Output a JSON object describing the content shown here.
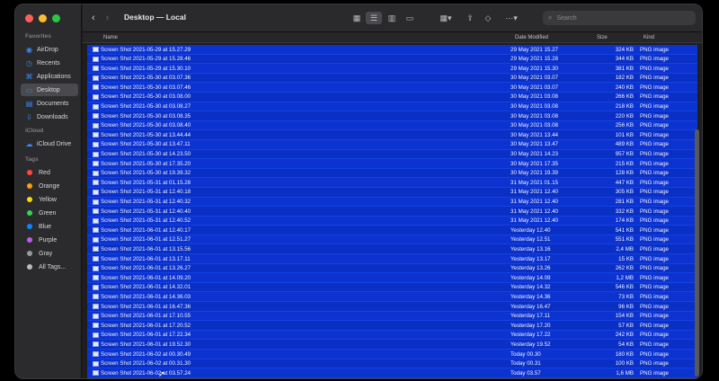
{
  "window": {
    "title": "Desktop — Local",
    "search_placeholder": "Search"
  },
  "sidebar": {
    "favorites_header": "Favorites",
    "favorites": [
      {
        "label": "AirDrop",
        "icon": "airdrop-icon"
      },
      {
        "label": "Recents",
        "icon": "clock-icon"
      },
      {
        "label": "Applications",
        "icon": "applications-icon"
      },
      {
        "label": "Desktop",
        "icon": "desktop-icon"
      },
      {
        "label": "Documents",
        "icon": "document-icon"
      },
      {
        "label": "Downloads",
        "icon": "download-icon"
      }
    ],
    "icloud_header": "iCloud",
    "icloud": [
      {
        "label": "iCloud Drive",
        "icon": "cloud-icon"
      }
    ],
    "tags_header": "Tags",
    "tags": [
      {
        "label": "Red",
        "color": "#ff453a"
      },
      {
        "label": "Orange",
        "color": "#ff9f0a"
      },
      {
        "label": "Yellow",
        "color": "#ffd60a"
      },
      {
        "label": "Green",
        "color": "#32d74b"
      },
      {
        "label": "Blue",
        "color": "#0a84ff"
      },
      {
        "label": "Purple",
        "color": "#bf5af2"
      },
      {
        "label": "Gray",
        "color": "#98989d"
      },
      {
        "label": "All Tags...",
        "color": "#bbbbbb"
      }
    ]
  },
  "columns": {
    "name": "Name",
    "date": "Date Modified",
    "size": "Size",
    "kind": "Kind"
  },
  "files": [
    {
      "name": "Screen Shot 2021-05-29 at 15.27.29",
      "date": "29 May 2021 15.27",
      "size": "324 KB",
      "kind": "PNG image"
    },
    {
      "name": "Screen Shot 2021-05-29 at 15.28.46",
      "date": "29 May 2021 15.28",
      "size": "344 KB",
      "kind": "PNG image"
    },
    {
      "name": "Screen Shot 2021-05-29 at 15.30.10",
      "date": "29 May 2021 15.30",
      "size": "381 KB",
      "kind": "PNG image"
    },
    {
      "name": "Screen Shot 2021-05-30 at 03.07.36",
      "date": "30 May 2021 03.07",
      "size": "182 KB",
      "kind": "PNG image"
    },
    {
      "name": "Screen Shot 2021-05-30 at 03.07.46",
      "date": "30 May 2021 03.07",
      "size": "240 KB",
      "kind": "PNG image"
    },
    {
      "name": "Screen Shot 2021-05-30 at 03.08.00",
      "date": "30 May 2021 03.08",
      "size": "266 KB",
      "kind": "PNG image"
    },
    {
      "name": "Screen Shot 2021-05-30 at 03.08.27",
      "date": "30 May 2021 03.08",
      "size": "218 KB",
      "kind": "PNG image"
    },
    {
      "name": "Screen Shot 2021-05-30 at 03.08.35",
      "date": "30 May 2021 03.08",
      "size": "220 KB",
      "kind": "PNG image"
    },
    {
      "name": "Screen Shot 2021-05-30 at 03.08.40",
      "date": "30 May 2021 03.08",
      "size": "256 KB",
      "kind": "PNG image"
    },
    {
      "name": "Screen Shot 2021-05-30 at 13.44.44",
      "date": "30 May 2021 13.44",
      "size": "101 KB",
      "kind": "PNG image"
    },
    {
      "name": "Screen Shot 2021-05-30 at 13.47.11",
      "date": "30 May 2021 13.47",
      "size": "489 KB",
      "kind": "PNG image"
    },
    {
      "name": "Screen Shot 2021-05-30 at 14.23.50",
      "date": "30 May 2021 14.23",
      "size": "957 KB",
      "kind": "PNG image"
    },
    {
      "name": "Screen Shot 2021-05-30 at 17.35.20",
      "date": "30 May 2021 17.35",
      "size": "215 KB",
      "kind": "PNG image"
    },
    {
      "name": "Screen Shot 2021-05-30 at 19.39.32",
      "date": "30 May 2021 19.39",
      "size": "128 KB",
      "kind": "PNG image"
    },
    {
      "name": "Screen Shot 2021-05-31 at 01.15.28",
      "date": "31 May 2021 01.15",
      "size": "447 KB",
      "kind": "PNG image"
    },
    {
      "name": "Screen Shot 2021-05-31 at 12.40.18",
      "date": "31 May 2021 12.40",
      "size": "305 KB",
      "kind": "PNG image"
    },
    {
      "name": "Screen Shot 2021-05-31 at 12.40.32",
      "date": "31 May 2021 12.40",
      "size": "281 KB",
      "kind": "PNG image"
    },
    {
      "name": "Screen Shot 2021-05-31 at 12.40.40",
      "date": "31 May 2021 12.40",
      "size": "332 KB",
      "kind": "PNG image"
    },
    {
      "name": "Screen Shot 2021-05-31 at 12.40.52",
      "date": "31 May 2021 12.40",
      "size": "174 KB",
      "kind": "PNG image"
    },
    {
      "name": "Screen Shot 2021-06-01 at 12.40.17",
      "date": "Yesterday 12.40",
      "size": "541 KB",
      "kind": "PNG image"
    },
    {
      "name": "Screen Shot 2021-06-01 at 12.51.27",
      "date": "Yesterday 12.51",
      "size": "551 KB",
      "kind": "PNG image"
    },
    {
      "name": "Screen Shot 2021-06-01 at 13.15.56",
      "date": "Yesterday 13.16",
      "size": "2,4 MB",
      "kind": "PNG image"
    },
    {
      "name": "Screen Shot 2021-06-01 at 13.17.11",
      "date": "Yesterday 13.17",
      "size": "15 KB",
      "kind": "PNG image"
    },
    {
      "name": "Screen Shot 2021-06-01 at 13.26.27",
      "date": "Yesterday 13.26",
      "size": "262 KB",
      "kind": "PNG image"
    },
    {
      "name": "Screen Shot 2021-06-01 at 14.09.20",
      "date": "Yesterday 14.09",
      "size": "1,2 MB",
      "kind": "PNG image"
    },
    {
      "name": "Screen Shot 2021-06-01 at 14.32.01",
      "date": "Yesterday 14.32",
      "size": "546 KB",
      "kind": "PNG image"
    },
    {
      "name": "Screen Shot 2021-06-01 at 14.36.03",
      "date": "Yesterday 14.36",
      "size": "73 KB",
      "kind": "PNG image"
    },
    {
      "name": "Screen Shot 2021-06-01 at 16.47.36",
      "date": "Yesterday 16.47",
      "size": "96 KB",
      "kind": "PNG image"
    },
    {
      "name": "Screen Shot 2021-06-01 at 17.10.55",
      "date": "Yesterday 17.11",
      "size": "154 KB",
      "kind": "PNG image"
    },
    {
      "name": "Screen Shot 2021-06-01 at 17.20.52",
      "date": "Yesterday 17.20",
      "size": "57 KB",
      "kind": "PNG image"
    },
    {
      "name": "Screen Shot 2021-06-01 at 17.22.34",
      "date": "Yesterday 17.22",
      "size": "242 KB",
      "kind": "PNG image"
    },
    {
      "name": "Screen Shot 2021-06-01 at 19.52.30",
      "date": "Yesterday 19.52",
      "size": "54 KB",
      "kind": "PNG image"
    },
    {
      "name": "Screen Shot 2021-06-02 at 00.30.49",
      "date": "Today 00.30",
      "size": "180 KB",
      "kind": "PNG image"
    },
    {
      "name": "Screen Shot 2021-06-02 at 00.31.30",
      "date": "Today 00.31",
      "size": "100 KB",
      "kind": "PNG image"
    },
    {
      "name": "Screen Shot 2021-06-02 at 03.57.24",
      "date": "Today 03.57",
      "size": "1,6 MB",
      "kind": "PNG image"
    }
  ]
}
